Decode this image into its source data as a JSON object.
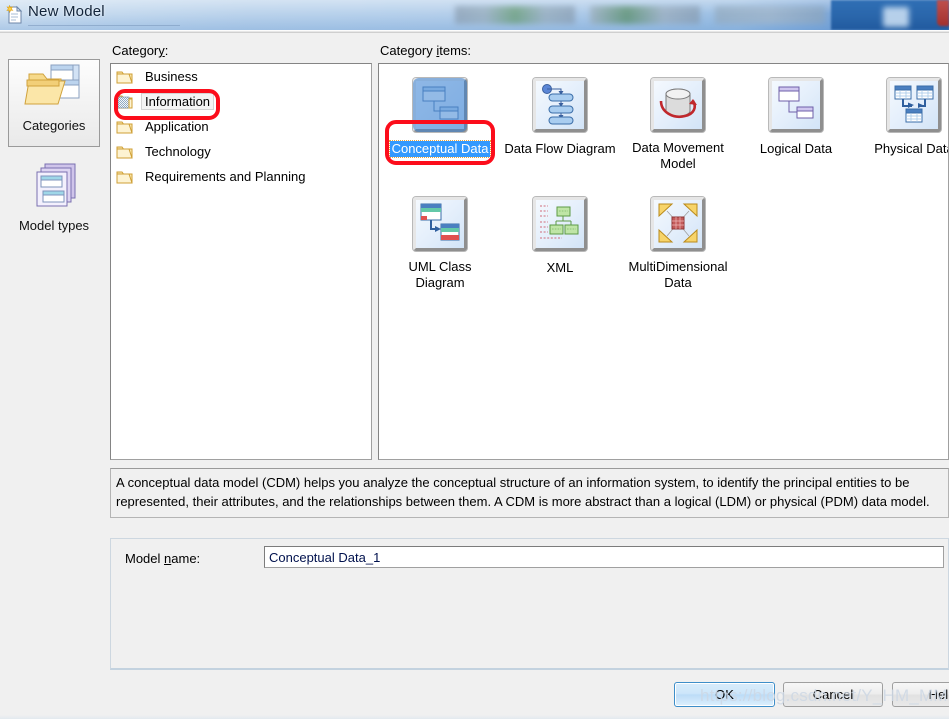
{
  "window": {
    "title": "New Model",
    "icon": "new-document-icon"
  },
  "labels": {
    "category": "Category:",
    "category_items": "Category items:",
    "model_name": "Model name:"
  },
  "rail": {
    "items": [
      {
        "label": "Categories",
        "icon": "folder-documents-icon",
        "selected": true
      },
      {
        "label": "Model types",
        "icon": "stacked-models-icon",
        "selected": false
      }
    ]
  },
  "category_list": {
    "items": [
      {
        "label": "Business",
        "icon": "folder-icon",
        "selected": false
      },
      {
        "label": "Information",
        "icon": "folder-open-icon",
        "selected": true
      },
      {
        "label": "Application",
        "icon": "folder-icon",
        "selected": false
      },
      {
        "label": "Technology",
        "icon": "folder-icon",
        "selected": false
      },
      {
        "label": "Requirements and Planning",
        "icon": "folder-icon",
        "selected": false
      }
    ]
  },
  "category_items": {
    "items": [
      {
        "label": "Conceptual Data",
        "icon": "conceptual-data-icon",
        "selected": true
      },
      {
        "label": "Data Flow Diagram",
        "icon": "data-flow-diagram-icon",
        "selected": false
      },
      {
        "label": "Data Movement Model",
        "icon": "data-movement-model-icon",
        "selected": false
      },
      {
        "label": "Logical Data",
        "icon": "logical-data-icon",
        "selected": false
      },
      {
        "label": "Physical Data",
        "icon": "physical-data-icon",
        "selected": false
      },
      {
        "label": "UML Class Diagram",
        "icon": "uml-class-diagram-icon",
        "selected": false
      },
      {
        "label": "XML",
        "icon": "xml-icon",
        "selected": false
      },
      {
        "label": "MultiDimensional Data",
        "icon": "multidimensional-data-icon",
        "selected": false
      }
    ]
  },
  "description": "A conceptual data model (CDM) helps you analyze the conceptual structure of an information system, to identify the principal entities to be represented, their attributes, and the relationships between them. A CDM is more abstract than a logical (LDM) or physical (PDM) data model.",
  "model_name_value": "Conceptual Data_1",
  "buttons": {
    "ok": "OK",
    "cancel": "Cancel",
    "help": "Help"
  },
  "watermark": "https://blog.csdn.net/Y_HM_MM",
  "colors": {
    "annotation_red": "#fc0d1b",
    "selection_blue": "#3399ff",
    "dialog_bg": "#f0f0f0",
    "panel_bg": "#ffffff"
  }
}
